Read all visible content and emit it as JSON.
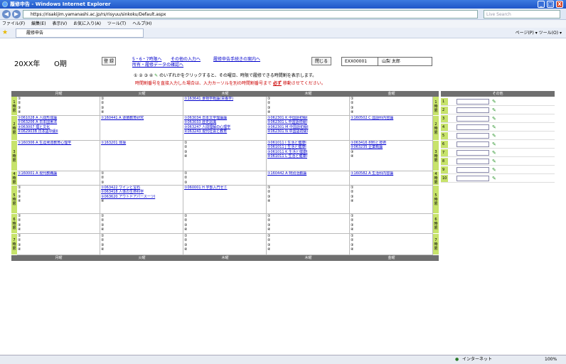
{
  "window": {
    "title": "履修申告 - Windows Internet Explorer",
    "min": "_",
    "max": "□",
    "close": "X"
  },
  "browser": {
    "back": "◀",
    "fwd": "▶",
    "url": "https://risakijim.yamanashi.ac.jp/rs/risyuu/sinkoku/Default.aspx",
    "search_placeholder": "Live Search",
    "menu": [
      "ファイル(F)",
      "編集(E)",
      "表示(V)",
      "お気に入り(A)",
      "ツール(T)",
      "ヘルプ(H)"
    ],
    "tab_label": "履修申告",
    "tools": "ページ(P) ▾  ツール(O) ▾",
    "status_zone": "インターネット",
    "status_zoom": "100%"
  },
  "page": {
    "year": "20XX年",
    "term": "O期",
    "register_button": "登 録",
    "link1a": "5・6・7時限へ",
    "link1b": "その他の入力へ",
    "link1c": "履修申告手続きの案内へ",
    "link2": "所有・履修データの確認へ",
    "close_button": "閉じる",
    "student_id": "EXX00001",
    "student_name": "山梨 太郎",
    "note_marks": "① ② ③ ④",
    "note_text": "のいずれかをクリックすると、その曜日、時限で履修できる時間割を表示します。",
    "note_red_a": "時間割番号を直接入力した場合は、入力カーソルを別の時間割番号まで",
    "note_red_em": "必ず",
    "note_red_b": "移動させてください。"
  },
  "timetable": {
    "days": [
      "月曜",
      "火曜",
      "木曜",
      "木曜",
      "金曜"
    ],
    "periods": [
      "1\n時\n限",
      "2\n時\n限",
      "3\n時\n限",
      "4\n時\n限",
      "5\n時\n限",
      "6\n時\n限",
      "7\n時\n限"
    ],
    "rows": [
      [
        [
          "① ",
          "② ",
          "③ ",
          "④ "
        ],
        [
          "① ",
          "② ",
          "③ ",
          "④ "
        ],
        [
          "①163641 食物学概論(栄養学)"
        ],
        [
          "① ",
          "② ",
          "③ ",
          "④ "
        ],
        [
          "① ",
          "② ",
          "③ ",
          "④ "
        ]
      ],
      [
        [
          "①061028 A 人間形成論",
          "②063206 A 日本国憲法",
          "③063007  理と文化",
          "④062903B 日本語中級II"
        ],
        [
          "①160441 A 道徳教育研究"
        ],
        [
          "①063034 日本文学理論論",
          "②063033 歴史認識",
          "③063247 人間理解の心理学",
          "④063243 現代社会と教育"
        ],
        [
          "①062301 K 中国語初級I",
          "②062301 L 中国語初級I",
          "③062301 M 中国語初級I",
          "④062301 N 中国語初級I"
        ],
        [
          "①160502 C 国語科内容論"
        ]
      ],
      [
        [
          "①160306 A 生涯発達教育心理学"
        ],
        [
          "①163201 体操"
        ],
        [
          "① ",
          "② ",
          "③ ",
          "④ "
        ],
        [
          "①061011 I 生活と健康I",
          "②061011 J 生活と健康I",
          "③061011 K 生活と健康I",
          "④061011 L 生活と健康I"
        ],
        [
          "①063416 材料と技術",
          "②063235 企業概論",
          "③ ",
          "④ "
        ]
      ],
      [
        [
          "①160001 A 現代教職論"
        ],
        [
          "① ",
          "② ",
          "③ ",
          "④ "
        ],
        [
          "① ",
          "② ",
          "③ ",
          "④ "
        ],
        [
          "①160442 A 特別活動論"
        ],
        [
          "①160582 A 生活科内容論"
        ]
      ],
      [
        [
          "① ",
          "② ",
          "③ ",
          "④ "
        ],
        [
          "①063422 ワインと宝石",
          "②063418 人体の生命科学",
          "③063620 アウトドアパースーツI",
          "④ "
        ],
        [
          "①060001 H 学部入門ゼミ"
        ],
        [
          "① ",
          "② ",
          "③ ",
          "④ "
        ],
        [
          "① ",
          "② ",
          "③ ",
          "④ "
        ]
      ],
      [
        [
          "① ",
          "② ",
          "③ ",
          "④ "
        ],
        [
          "① ",
          "② ",
          "③ ",
          "④ "
        ],
        [
          "① ",
          "② ",
          "③ ",
          "④ "
        ],
        [
          "① ",
          "② ",
          "③ ",
          "④ "
        ],
        [
          "① ",
          "② ",
          "③ ",
          "④ "
        ]
      ],
      [
        [
          "① ",
          "② ",
          "③ ",
          "④ "
        ],
        [
          "① ",
          "② ",
          "③ ",
          "④ "
        ],
        [
          "① ",
          "② ",
          "③ ",
          "④ "
        ],
        [
          "① ",
          "② ",
          "③ ",
          "④ "
        ],
        [
          "① ",
          "② ",
          "③ ",
          "④ "
        ]
      ]
    ]
  },
  "other": {
    "header": "その他",
    "rows": [
      "1",
      "2",
      "3",
      "4",
      "5",
      "6",
      "7",
      "8",
      "9",
      "10"
    ]
  }
}
